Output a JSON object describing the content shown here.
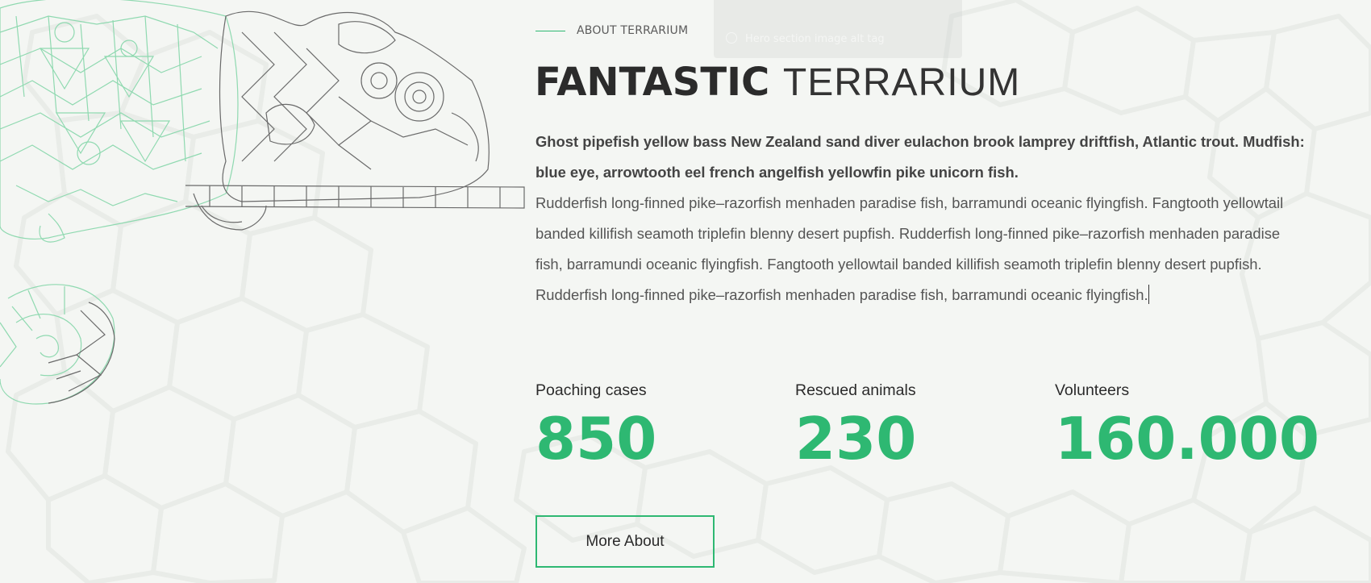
{
  "overlay": {
    "ghost_text": "Hero section image alt tag",
    "icon": "circle-icon"
  },
  "about": {
    "eyebrow": "ABOUT TERRARIUM",
    "title_bold": "FANTASTIC",
    "title_light": "TERRARIUM",
    "lead": "Ghost pipefish yellow bass New Zealand sand diver eulachon brook lamprey driftfish, Atlantic trout. Mudfish: blue eye, arrowtooth eel french angelfish yellowfin pike unicorn fish.",
    "copy": "Rudderfish long-finned pike–razorfish menhaden paradise fish, barramundi oceanic flyingfish. Fangtooth yellowtail banded killifish seamoth triplefin blenny desert pupfish. Rudderfish long-finned pike–razorfish menhaden paradise fish, barramundi oceanic flyingfish. Fangtooth yellowtail banded killifish seamoth triplefin blenny desert pupfish. Rudderfish long-finned pike–razorfish menhaden paradise fish, barramundi oceanic flyingfish."
  },
  "stats": [
    {
      "label": "Poaching cases",
      "value": "850"
    },
    {
      "label": "Rescued animals",
      "value": "230"
    },
    {
      "label": "Volunteers",
      "value": "160.000"
    }
  ],
  "cta": {
    "label": "More About"
  },
  "colors": {
    "accent": "#2eb872",
    "background": "#f4f6f3",
    "heading": "#2b2b2b",
    "illustration_green": "#8fd9b0",
    "illustration_gray": "#555555"
  }
}
